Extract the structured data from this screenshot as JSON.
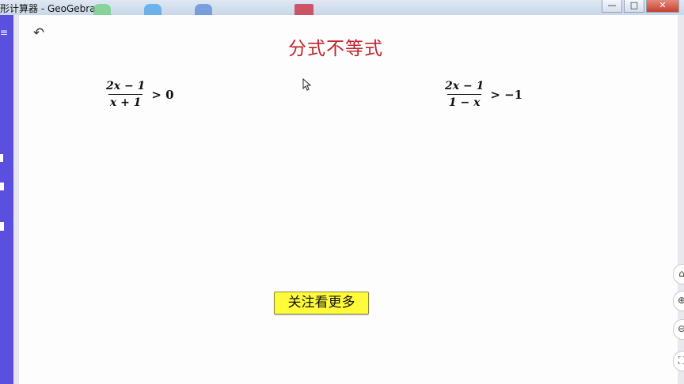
{
  "window": {
    "title": "形计算器 - GeoGebra",
    "controls": {
      "minimize": "—",
      "maximize": "□",
      "close": "✕"
    }
  },
  "icons": {
    "undo": "undo-icon",
    "menu": "menu-icon",
    "cursor": "mouse-pointer-icon",
    "home": "home-icon",
    "zoom_in": "zoom-in-icon",
    "zoom_out": "zoom-out-icon",
    "fullscreen": "fullscreen-icon"
  },
  "graphics": {
    "heading": "分式不等式",
    "inequality_left": {
      "numerator": "2x − 1",
      "denominator": "x + 1",
      "relation": "> 0"
    },
    "inequality_right": {
      "numerator": "2x − 1",
      "denominator": "1 − x",
      "relation": "> −1"
    },
    "follow_button": "关注看更多"
  },
  "colors": {
    "heading": "#c0242a",
    "button_bg": "#fffb3b",
    "side_strip": "#5b4fe0"
  }
}
